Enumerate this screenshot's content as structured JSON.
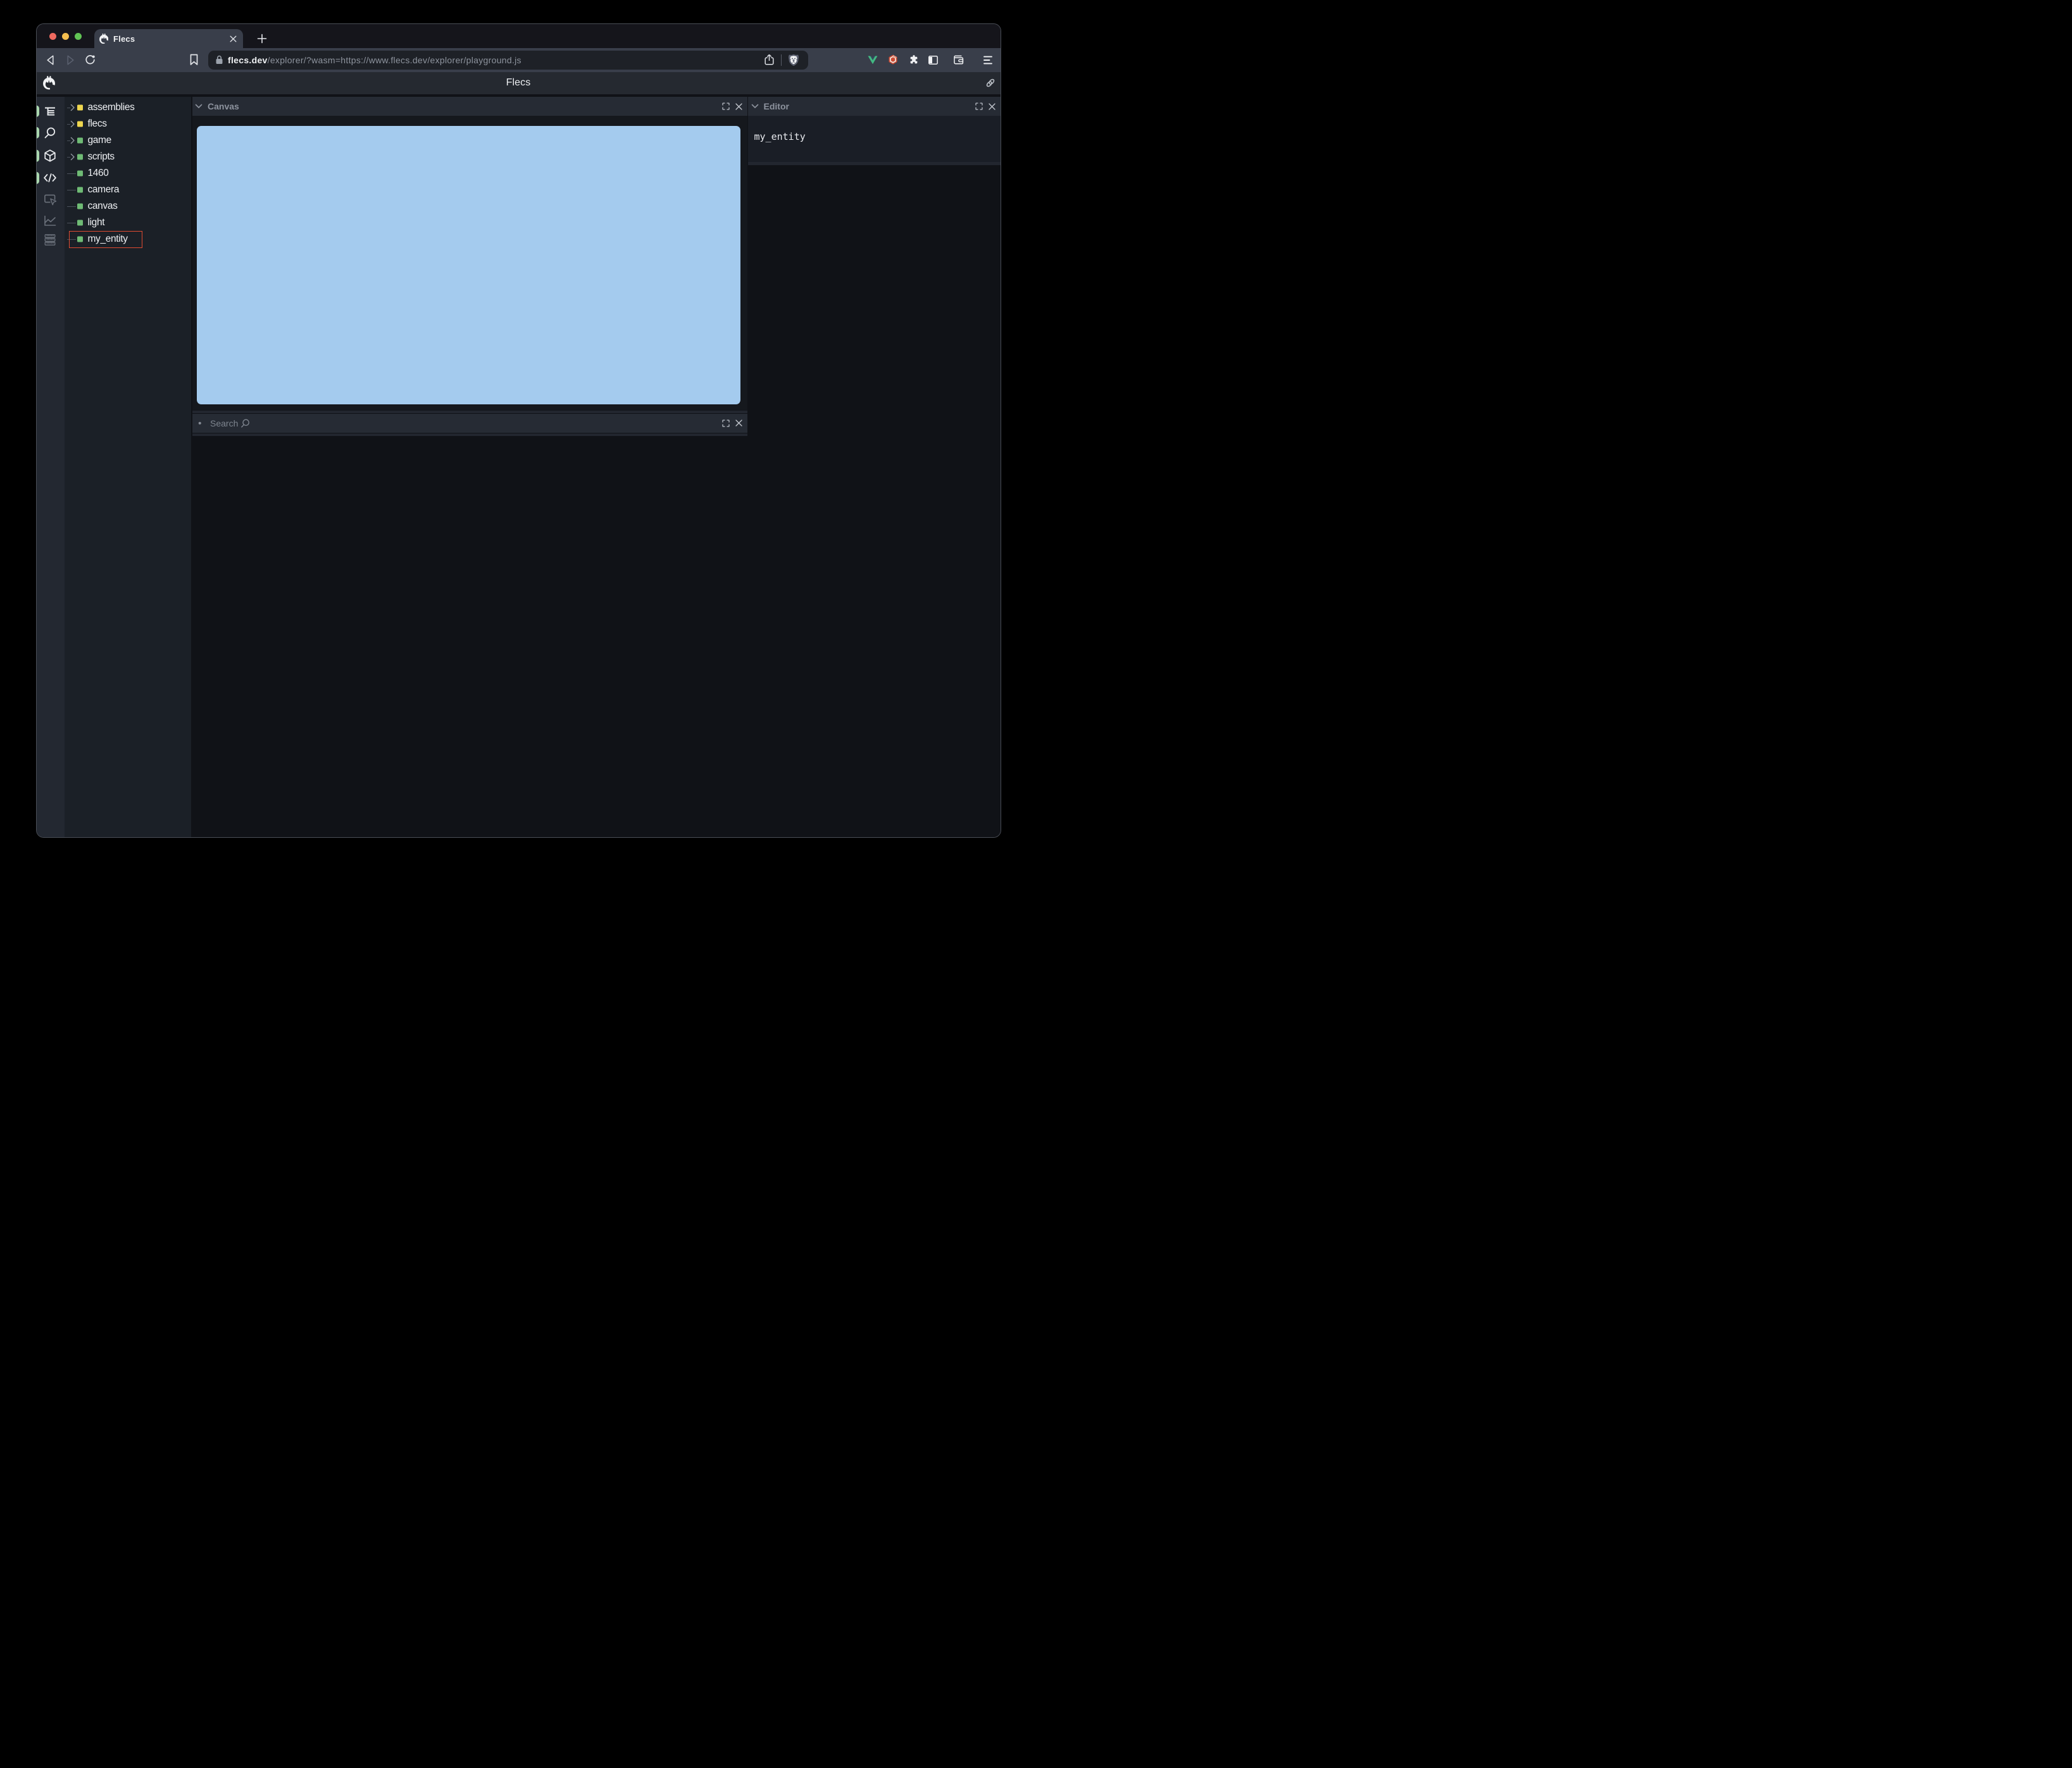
{
  "browser": {
    "tab_title": "Flecs",
    "tabstrip_icons": [
      "flecs-favicon",
      "tab-close",
      "new-tab-plus"
    ],
    "url": {
      "domain": "flecs.dev",
      "rest": "/explorer/?wasm=https://www.flecs.dev/explorer/playground.js"
    },
    "traffic_lights": {
      "close": "#ee6a5f",
      "minimize": "#f5bf4f",
      "zoom": "#61c454"
    },
    "toolbar_icons": [
      "back",
      "forward",
      "reload",
      "bookmark",
      "share",
      "brave-shield",
      "vue-devtools",
      "extension-hexagon",
      "extensions-puzzle",
      "sidebar",
      "wallet",
      "menu"
    ]
  },
  "app": {
    "title": "Flecs",
    "header_icons": [
      "flecs-logo",
      "permalink"
    ]
  },
  "sidebar": {
    "items": [
      {
        "name": "tree",
        "active": true
      },
      {
        "name": "search",
        "active": true
      },
      {
        "name": "entities",
        "active": true
      },
      {
        "name": "editor",
        "active": true
      },
      {
        "name": "inspector",
        "active": false
      },
      {
        "name": "stats",
        "active": false
      },
      {
        "name": "commands",
        "active": false
      }
    ],
    "active_indicator_color": "#a9d7ad"
  },
  "tree": {
    "items": [
      {
        "label": "assemblies",
        "kind": "module",
        "expandable": true,
        "selected": false
      },
      {
        "label": "flecs",
        "kind": "module",
        "expandable": true,
        "selected": false
      },
      {
        "label": "game",
        "kind": "entity",
        "expandable": true,
        "selected": false
      },
      {
        "label": "scripts",
        "kind": "entity",
        "expandable": true,
        "selected": false
      },
      {
        "label": "1460",
        "kind": "entity",
        "expandable": false,
        "selected": false
      },
      {
        "label": "camera",
        "kind": "entity",
        "expandable": false,
        "selected": false
      },
      {
        "label": "canvas",
        "kind": "entity",
        "expandable": false,
        "selected": false
      },
      {
        "label": "light",
        "kind": "entity",
        "expandable": false,
        "selected": false
      },
      {
        "label": "my_entity",
        "kind": "entity",
        "expandable": false,
        "selected": true
      }
    ],
    "module_color": "#eed64f",
    "entity_color": "#6fbb75",
    "selection_color": "#e04b31"
  },
  "panels": {
    "canvas": {
      "title": "Canvas",
      "buttons": [
        "fullscreen",
        "close"
      ],
      "surface_color": "#a4cbee"
    },
    "search": {
      "title": "Search",
      "buttons": [
        "fullscreen",
        "close"
      ]
    },
    "editor": {
      "title": "Editor",
      "buttons": [
        "fullscreen",
        "close"
      ],
      "content": "my_entity"
    }
  }
}
